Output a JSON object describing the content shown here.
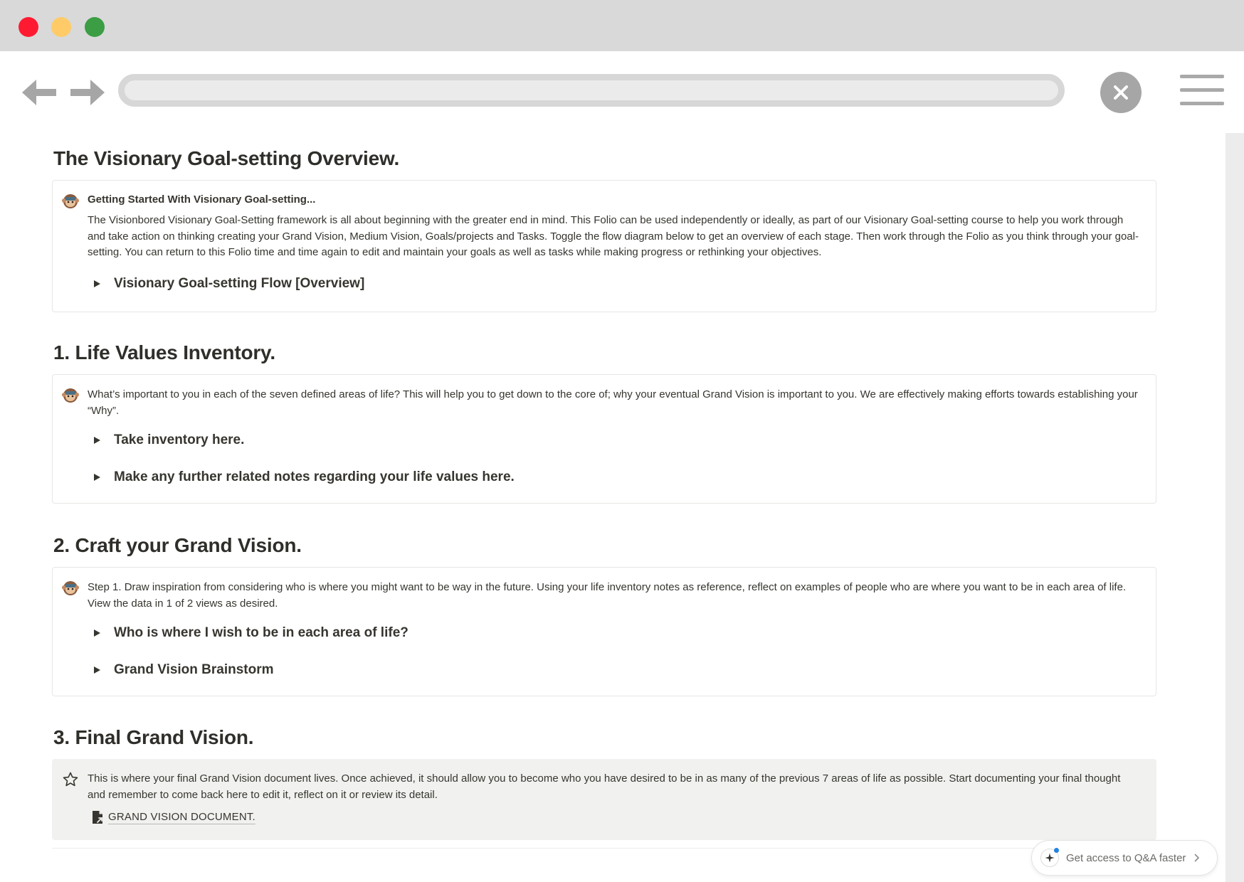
{
  "window": {
    "buttons": [
      "close",
      "minimize",
      "maximize"
    ],
    "colors": {
      "close": "#fe1b32",
      "minimize": "#fecb68",
      "maximize": "#3b9d44",
      "titlebar": "#d9d9d9"
    }
  },
  "browser": {
    "address_value": "",
    "icons": {
      "back": "arrow-left-icon",
      "forward": "arrow-right-icon",
      "close": "close-icon",
      "menu": "hamburger-menu-icon"
    }
  },
  "sections": [
    {
      "heading": "The Visionary Goal-setting Overview.",
      "callout": {
        "icon": "monkey-emoji-icon",
        "title": "Getting Started With Visionary Goal-setting...",
        "text": "The Visionbored Visionary Goal-Setting framework is all about beginning with the greater end in mind. This Folio can be used independently or ideally, as part of our Visionary Goal-setting course to help you work through and take action on thinking creating your Grand Vision, Medium Vision, Goals/projects and Tasks. Toggle the flow diagram below to get an overview of each stage. Then work through the Folio as you think through your goal-setting. You can return to this Folio time and time again to edit and maintain your goals as well as tasks while making progress or rethinking your objectives.",
        "toggles": [
          "Visionary Goal-setting Flow [Overview]"
        ]
      }
    },
    {
      "heading": "1. Life Values Inventory.",
      "callout": {
        "icon": "monkey-emoji-icon",
        "text": "What’s important to you in each of the seven defined areas of life? This will help you to get down to the core of; why your eventual Grand Vision is important to you. We are effectively making efforts towards establishing your “Why”.",
        "toggles": [
          "Take inventory here.",
          "Make any further related notes regarding your life values here."
        ]
      }
    },
    {
      "heading": "2. Craft your Grand Vision.",
      "callout": {
        "icon": "monkey-emoji-icon",
        "text": "Step 1. Draw inspiration from considering who is where you might want to be way in the future. Using your life inventory notes as reference, reflect on examples of people who are where you want to be in each area of life. View the data in 1 of 2 views as desired.",
        "toggles": [
          "Who is where I wish to be in each area of life?",
          "Grand Vision Brainstorm"
        ]
      }
    },
    {
      "heading": "3. Final Grand Vision.",
      "callout": {
        "icon": "star-outline-icon",
        "text": "This is where your final Grand Vision document lives. Once achieved, it should allow you to become who you have desired to be in as many of the previous 7 areas of life as possible. Start documenting your final thought and remember to come back here to edit it, reflect on it or review its detail.",
        "link": {
          "icon": "page-link-icon",
          "label": "GRAND VISION DOCUMENT."
        }
      }
    }
  ],
  "qa_prompt": {
    "text": "Get access to Q&A faster",
    "icon": "ai-sparkle-icon",
    "accent": "#2383e2"
  }
}
